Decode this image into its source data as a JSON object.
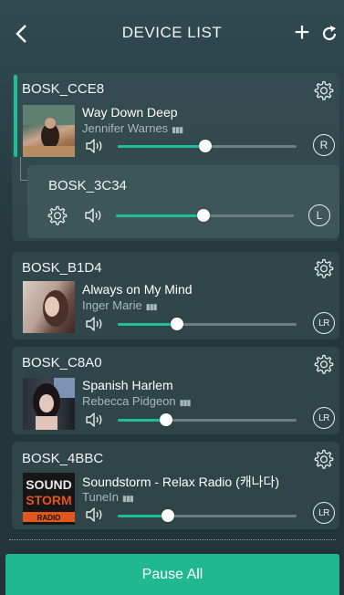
{
  "header": {
    "title": "DEVICE LIST",
    "back_icon": "chevron-left-icon",
    "add_icon": "plus-icon",
    "refresh_icon": "refresh-icon",
    "add_label": "+"
  },
  "accent_color": "#1fbf95",
  "devices": [
    {
      "name": "BOSK_CCE8",
      "song": "Way Down Deep",
      "artist": "Jennifer Warnes",
      "volume": 0.49,
      "channel": "R"
    },
    {
      "name": "BOSK_3C34",
      "volume": 0.49,
      "channel": "L"
    },
    {
      "name": "BOSK_B1D4",
      "song": "Always on My Mind",
      "artist": "Inger Marie",
      "volume": 0.33,
      "channel": "LR"
    },
    {
      "name": "BOSK_C8A0",
      "song": "Spanish Harlem",
      "artist": "Rebecca Pidgeon",
      "volume": 0.27,
      "channel": "LR"
    },
    {
      "name": "BOSK_4BBC",
      "song": "Soundstorm - Relax Radio (캐나다)",
      "artist": "TuneIn",
      "volume": 0.28,
      "channel": "LR",
      "art_text": [
        "SOUND",
        "STORM",
        "RADIO"
      ]
    }
  ],
  "footer": {
    "pause_all_label": "Pause All"
  }
}
